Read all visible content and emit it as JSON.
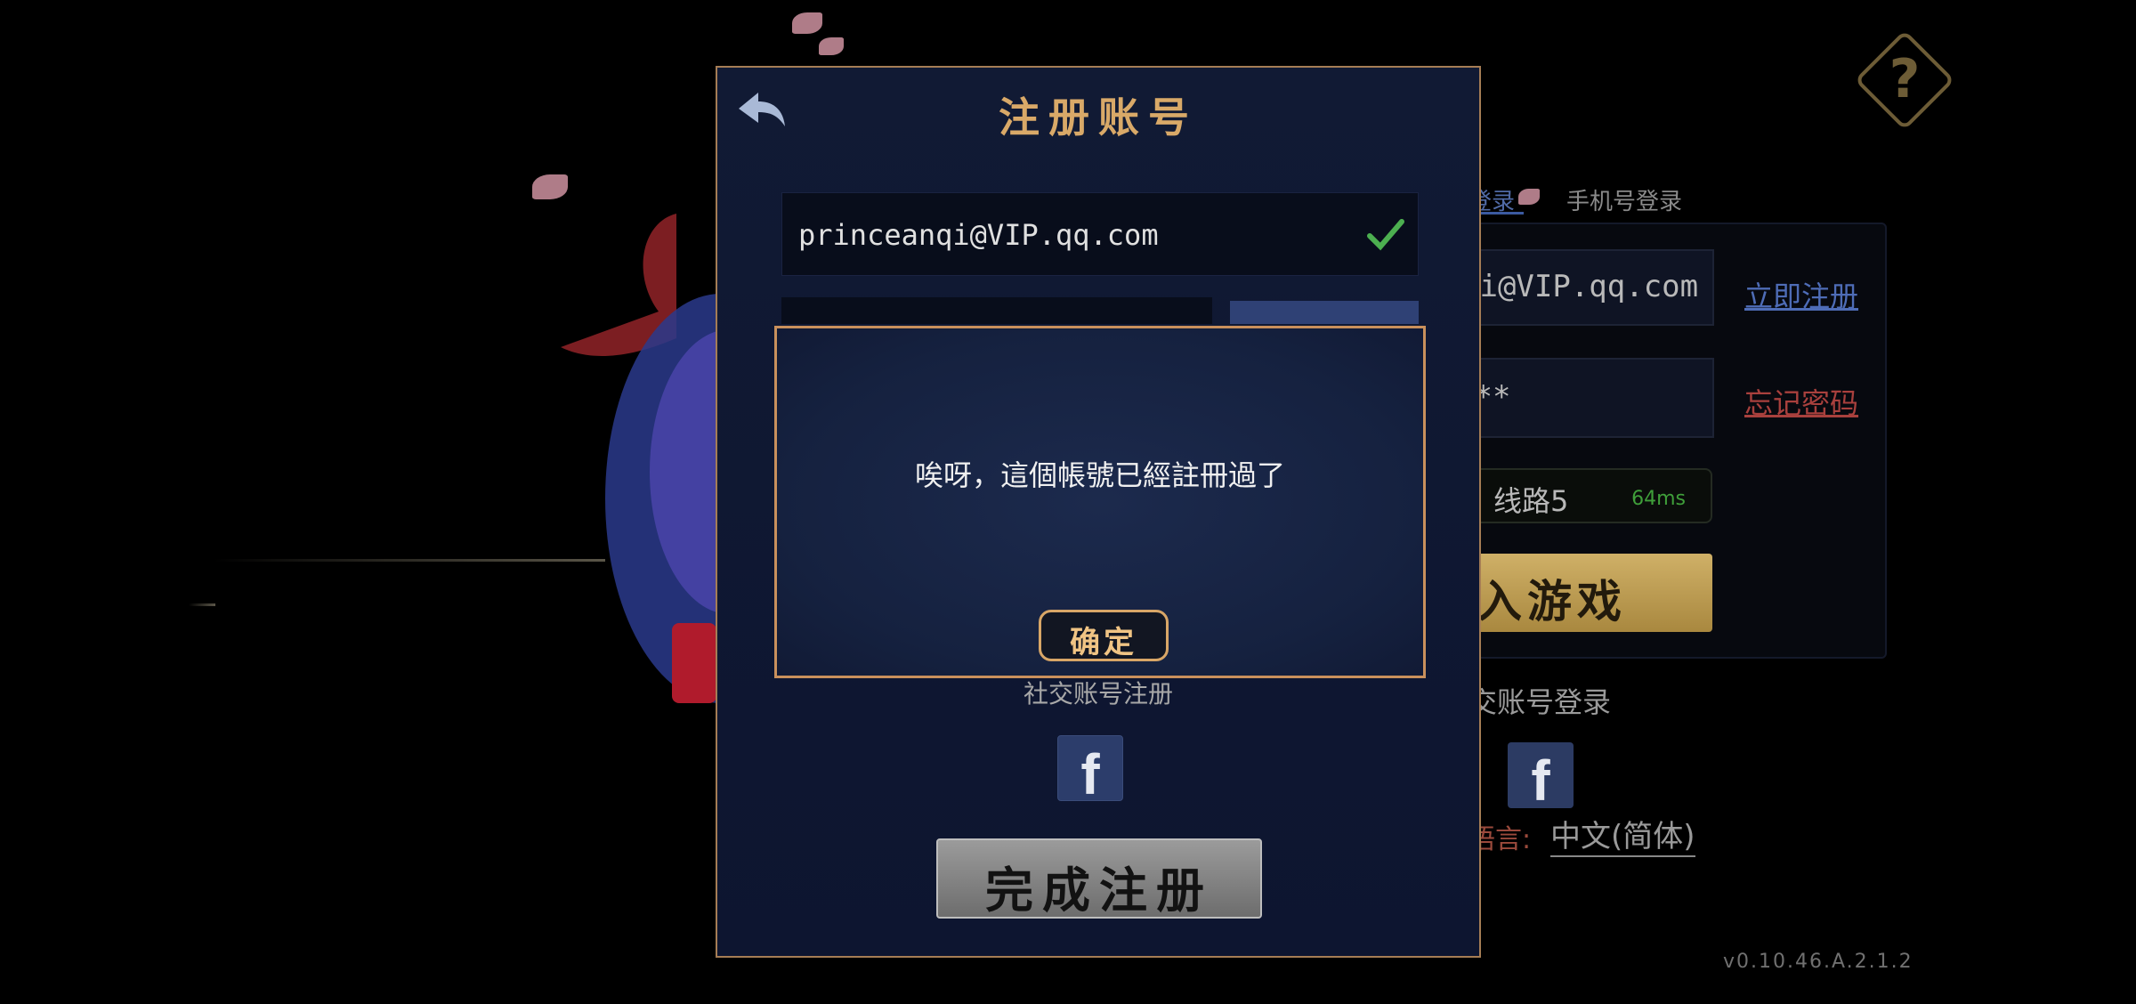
{
  "background_login": {
    "tab_account_partial": "登录",
    "tab_phone": "手机号登录",
    "account_value_partial": "qi@VIP.qq.com",
    "register_link": "立即注册",
    "password_masked": "***",
    "forgot_link": "忘记密码",
    "server_name": "线路5",
    "server_ping": "64ms",
    "enter_button_partial": "入游戏",
    "social_login_partial": "交账号登录",
    "language_label_partial": "语言:",
    "language_value": "中文(简体)",
    "version": "v0.10.46.A.2.1.2"
  },
  "register_dialog": {
    "title": "注册账号",
    "email_value": "princeanqi@VIP.qq.com",
    "social_register_partial": "社交账号注册",
    "facebook_letter": "f",
    "complete_button": "完成注册"
  },
  "alert": {
    "message": "唉呀，這個帳號已經註冊過了",
    "ok_button": "确定"
  },
  "colors": {
    "dialog_border": "#a57d55",
    "title_gold": "#d9a968",
    "check_green": "#4caf50",
    "link_blue": "#4e6cb6",
    "link_red": "#a8403d"
  }
}
